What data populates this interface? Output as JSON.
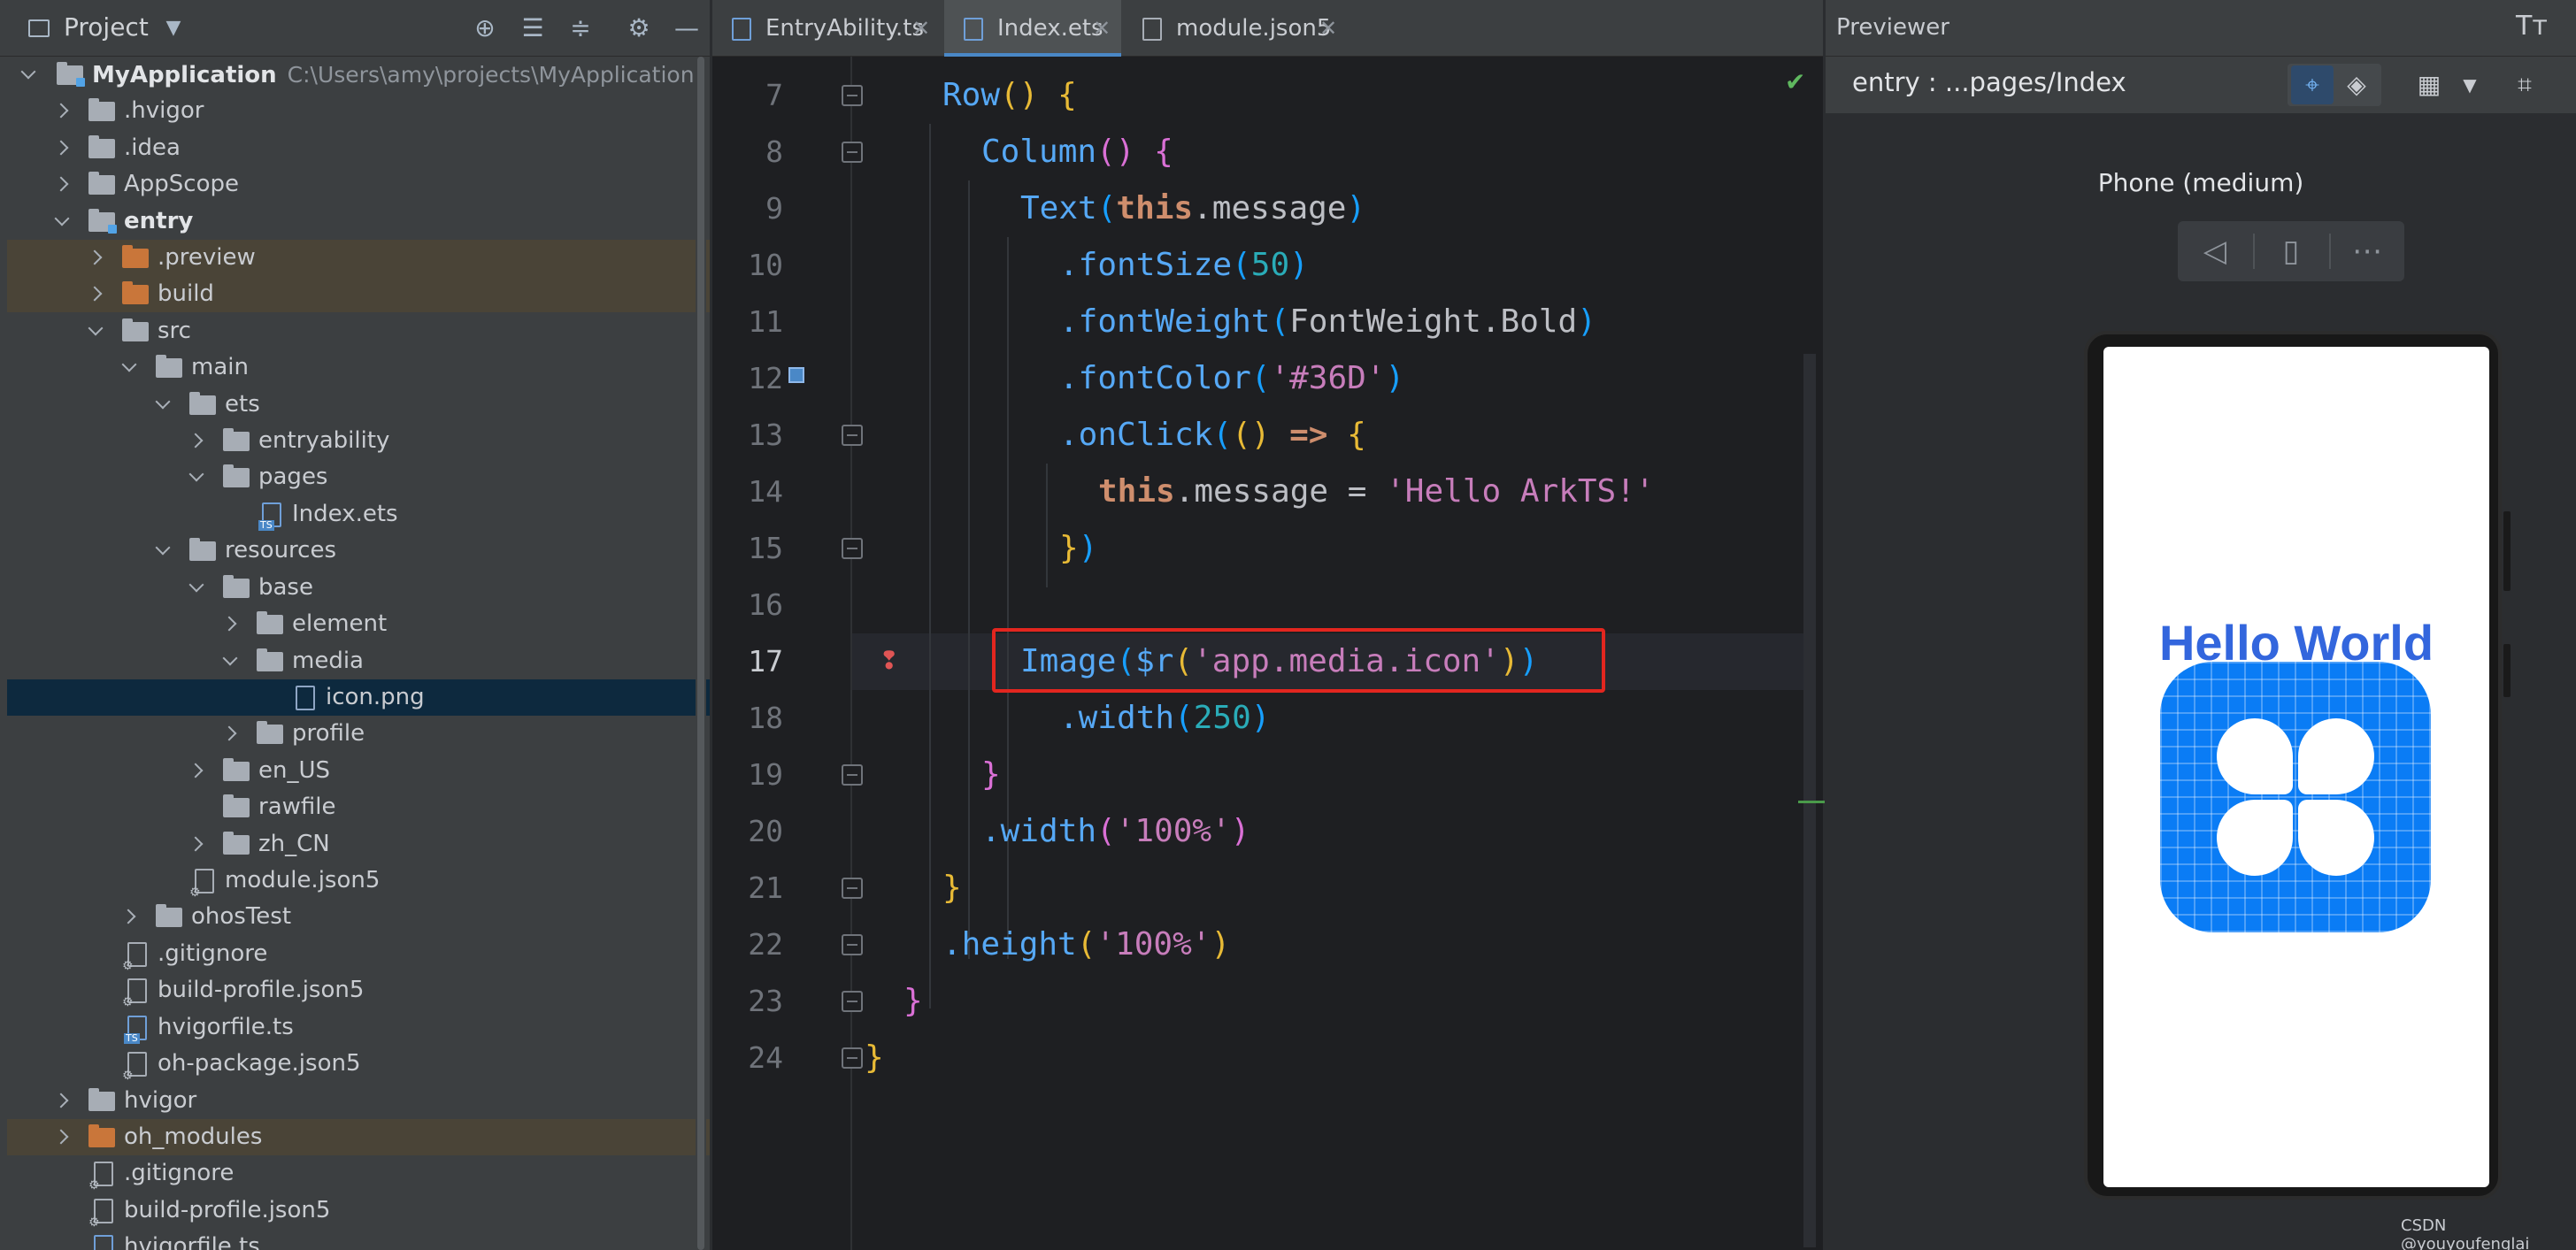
{
  "project": {
    "title": "Project",
    "tree": [
      {
        "label": "MyApplication",
        "path": "C:\\Users\\amy\\projects\\MyApplication",
        "bold": true
      },
      {
        "label": ".hvigor"
      },
      {
        "label": ".idea"
      },
      {
        "label": "AppScope"
      },
      {
        "label": "entry",
        "bold": true
      },
      {
        "label": ".preview"
      },
      {
        "label": "build"
      },
      {
        "label": "src"
      },
      {
        "label": "main"
      },
      {
        "label": "ets"
      },
      {
        "label": "entryability"
      },
      {
        "label": "pages"
      },
      {
        "label": "Index.ets"
      },
      {
        "label": "resources"
      },
      {
        "label": "base"
      },
      {
        "label": "element"
      },
      {
        "label": "media"
      },
      {
        "label": "icon.png"
      },
      {
        "label": "profile"
      },
      {
        "label": "en_US"
      },
      {
        "label": "rawfile"
      },
      {
        "label": "zh_CN"
      },
      {
        "label": "module.json5"
      },
      {
        "label": "ohosTest"
      },
      {
        "label": ".gitignore"
      },
      {
        "label": "build-profile.json5"
      },
      {
        "label": "hvigorfile.ts"
      },
      {
        "label": "oh-package.json5"
      },
      {
        "label": "hvigor"
      },
      {
        "label": "oh_modules"
      },
      {
        "label": ".gitignore"
      },
      {
        "label": "build-profile.json5"
      },
      {
        "label": "hvigorfile.ts"
      }
    ]
  },
  "editor": {
    "tabs": [
      {
        "label": "EntryAbility.ts",
        "close": "✕"
      },
      {
        "label": "Index.ets",
        "close": "✕",
        "active": true
      },
      {
        "label": "module.json5",
        "close": "✕"
      }
    ],
    "line_numbers": [
      "7",
      "8",
      "9",
      "10",
      "11",
      "12",
      "13",
      "14",
      "15",
      "16",
      "17",
      "18",
      "19",
      "20",
      "21",
      "22",
      "23",
      "24"
    ],
    "current_line": "17",
    "code": {
      "l7": [
        "Row",
        "()",
        " {"
      ],
      "l8": [
        "Column",
        "()",
        " {"
      ],
      "l9": [
        "Text",
        "(",
        "this",
        ".message",
        ")"
      ],
      "l10": [
        ".fontSize",
        "(",
        "50",
        ")"
      ],
      "l11": [
        ".fontWeight",
        "(",
        "FontWeight.Bold",
        ")"
      ],
      "l12": [
        ".fontColor",
        "(",
        "'#36D'",
        ")"
      ],
      "l13": [
        ".onClick",
        "(",
        "()",
        " => ",
        "{"
      ],
      "l14": [
        "this",
        ".message = ",
        "'Hello ArkTS!'"
      ],
      "l15": [
        "}",
        ")"
      ],
      "l17": [
        "Image",
        "(",
        "$r",
        "(",
        "'app.media.icon'",
        ")",
        ")"
      ],
      "l18": [
        ".width",
        "(",
        "250",
        ")"
      ],
      "l19": [
        "}"
      ],
      "l20": [
        ".width",
        "(",
        "'100%'",
        ")"
      ],
      "l21": [
        "}"
      ],
      "l22": [
        ".height",
        "(",
        "'100%'",
        ")"
      ],
      "l23": [
        "}"
      ],
      "l24": [
        "}"
      ]
    }
  },
  "previewer": {
    "title": "Previewer",
    "path": "entry : ...pages/Index",
    "device": "Phone (medium)",
    "screen_text": "Hello World",
    "text_color": "#3366dd",
    "icon_color": "#0a7cf5"
  },
  "watermark": "CSDN @youyoufenglai"
}
